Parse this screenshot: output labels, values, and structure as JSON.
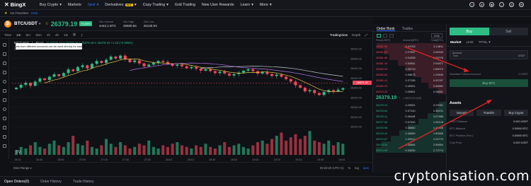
{
  "brand": {
    "name": "BingX"
  },
  "nav": {
    "items": [
      "Buy Crypto",
      "Markets",
      "Spot",
      "Derivatives",
      "Copy Trading",
      "Grid Trading",
      "New User Rewards",
      "Learn",
      "More"
    ],
    "derivatives_badge": "HOT"
  },
  "favorites": {
    "label": "No Favorites",
    "hide": "Hide"
  },
  "ticker": {
    "pair": "BTC/USDT",
    "price": "26379.19",
    "change": "+0.55%",
    "stats": [
      {
        "label": "24h Volume",
        "value": "4442.1 BTC"
      },
      {
        "label": "24h High",
        "value": "26600.84"
      },
      {
        "label": "24h Low",
        "value": "26130.93"
      }
    ]
  },
  "chart_toolbar": {
    "intervals": [
      "Time",
      "1m",
      "5m",
      "15m",
      "1h",
      "4h",
      "1D"
    ],
    "views": [
      "TradingView",
      "Depth"
    ]
  },
  "chart_legend": {
    "pair": "BTC/USDT · 1 · BingX",
    "ohlc": "O 26379.19  H 26379.19  L 26379.19  C 26379.19  +1.34 (+0.005%)"
  },
  "chart_data": {
    "type": "candlestick",
    "title": "",
    "x_ticks": [
      "26:15",
      "26:30",
      "26:45",
      "27:00",
      "27:15",
      "27:30",
      "27:45",
      "28:00",
      "28:15",
      "28:30",
      "28:45",
      "29:00",
      "29:15",
      "29:30",
      "29:45",
      "28:41"
    ],
    "y_ticks": [
      "26520.00",
      "26480.00",
      "26440.00",
      "26400.00",
      "26360.00",
      "26320.00",
      "26280.00",
      "26240.00",
      "26200.00"
    ],
    "ylim": [
      26200,
      26520
    ],
    "last_price_label": "26379.19",
    "series_close": [
      26360,
      26372,
      26380,
      26368,
      26385,
      26398,
      26392,
      26405,
      26415,
      26408,
      26420,
      26435,
      26428,
      26445,
      26452,
      26440,
      26458,
      26470,
      26462,
      26475,
      26488,
      26480,
      26492,
      26478,
      26465,
      26472,
      26460,
      26448,
      26455,
      26462,
      26470,
      26466,
      26458,
      26450,
      26455,
      26448,
      26440,
      26445,
      26438,
      26430,
      26436,
      26428,
      26420,
      26426,
      26418,
      26410,
      26416,
      26422,
      26430,
      26436,
      26428,
      26418,
      26424,
      26416,
      26408,
      26414,
      26405,
      26395,
      26385,
      26370,
      26360,
      26345,
      26350,
      26338,
      26330,
      26342,
      26350,
      26345,
      26352,
      26358
    ],
    "volume": [
      3,
      5,
      4,
      6,
      8,
      5,
      4,
      7,
      9,
      6,
      5,
      8,
      12,
      7,
      6,
      9,
      5,
      4,
      6,
      10,
      7,
      5,
      8,
      6,
      4,
      5,
      7,
      6,
      9,
      5,
      4,
      6,
      5,
      7,
      8,
      6,
      5,
      4,
      6,
      5,
      7,
      5,
      4,
      6,
      8,
      5,
      6,
      7,
      5,
      4,
      6,
      8,
      9,
      7,
      10,
      12,
      14,
      9,
      11,
      13,
      10,
      12,
      15,
      9,
      8,
      7,
      9,
      6,
      8,
      7
    ]
  },
  "chart_bottom": {
    "date_range": "Date Range",
    "clock": "03:23:20 (UTC+1)",
    "toggles": [
      "%",
      "log",
      "auto"
    ]
  },
  "orderbook": {
    "tabs": [
      "Order Book",
      "Trades"
    ],
    "precision": "0.01",
    "headers": [
      "Price(USDT)",
      "Amount(BTC)",
      "Total(BTC)"
    ],
    "asks": [
      {
        "price": "26381.94",
        "amount": "0.44762",
        "total": "3.14811",
        "depth": 0.95
      },
      {
        "price": "26381.93",
        "amount": "0.27987",
        "total": "2.69349",
        "depth": 0.85
      },
      {
        "price": "26381.68",
        "amount": "0.01058",
        "total": "2.52078",
        "depth": 0.78
      },
      {
        "price": "26381.44",
        "amount": "0.50581",
        "total": "2.04871",
        "depth": 0.66
      },
      {
        "price": "26380.93",
        "amount": "0.35713",
        "total": "1.65073",
        "depth": 0.55
      },
      {
        "price": "26380.62",
        "amount": "0.35873",
        "total": "1.29506",
        "depth": 0.45
      },
      {
        "price": "26380.41",
        "amount": "0.27155",
        "total": "0.93787",
        "depth": 0.34
      },
      {
        "price": "26380.03",
        "amount": "0.40001",
        "total": "0.66682",
        "depth": 0.24
      },
      {
        "price": "26379.20",
        "amount": "0.26681",
        "total": "0.26681",
        "depth": 0.12
      }
    ],
    "mid_price": "26379.19",
    "mid_sub": "≈ 26379.19 USD",
    "bids": [
      {
        "price": "26379.19",
        "amount": "0.29051",
        "total": "0.29051",
        "depth": 0.1
      },
      {
        "price": "26378.64",
        "amount": "0.07140",
        "total": "0.36191",
        "depth": 0.14
      },
      {
        "price": "26378.11",
        "amount": "0.36448",
        "total": "0.67588",
        "depth": 0.25
      },
      {
        "price": "26377.52",
        "amount": "0.37540",
        "total": "1.05128",
        "depth": 0.38
      },
      {
        "price": "26376.98",
        "amount": "0.38880",
        "total": "1.44008",
        "depth": 0.52
      },
      {
        "price": "26376.41",
        "amount": "0.36850",
        "total": "1.80858",
        "depth": 0.64
      },
      {
        "price": "26375.87",
        "amount": "0.39912",
        "total": "2.20770",
        "depth": 0.76
      },
      {
        "price": "26375.32",
        "amount": "0.38884",
        "total": "2.59654",
        "depth": 0.88
      },
      {
        "price": "26374.90",
        "amount": "0.33052",
        "total": "2.72774",
        "depth": 0.96
      }
    ]
  },
  "trade": {
    "buy": "Buy",
    "sell": "Sell",
    "order_types": [
      "Market",
      "Limit",
      "TP/SL"
    ],
    "amount_label": "Amount",
    "amount_placeholder": "Total",
    "amount_unit": "USDT",
    "tooltip": "Assets from different accounts can be used directly for trading.",
    "standard_funds_label": "Standard Futures Account",
    "standard_funds_value": "0 USDT",
    "buy_button": "Buy BTC",
    "assets_title": "Assets",
    "asset_buttons": [
      "Deposit",
      "Transfer",
      "Buy Crypto"
    ],
    "balances": [
      {
        "label": "USDT Balance",
        "value": "0.000 USDT"
      },
      {
        "label": "BTC Balance",
        "value": "0.00000 BTC"
      },
      {
        "label": "BTC Position (Pos.)",
        "value": "0.00000 BTC"
      },
      {
        "label": "Cost Price",
        "value": "0.000 USDT"
      }
    ]
  },
  "bottom_tabs": [
    "Open Orders(0)",
    "Order History",
    "Trade History"
  ],
  "watermark": "cryptonisation.com",
  "colors": {
    "up": "#2ebd85",
    "down": "#f6465d",
    "accent": "#2e6bff",
    "arrow": "#e02323"
  }
}
